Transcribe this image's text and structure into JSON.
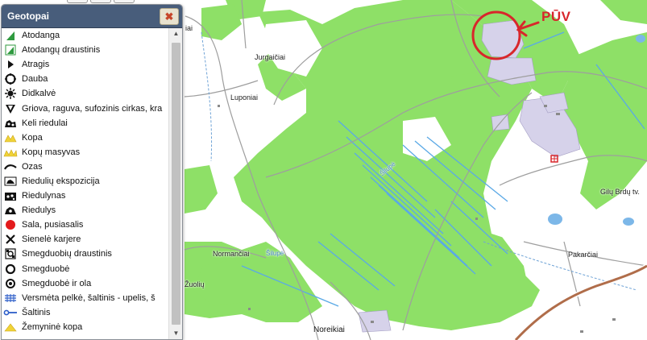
{
  "map": {
    "place_labels": {
      "jurgaiciai": "Jurgaičiai",
      "luponiai": "Luponiai",
      "normanciai": "Normančiai",
      "zuoliai": "Žuolių",
      "noreikiai": "Noreikiai",
      "pakarciai": "Pakarčiai",
      "aiai": "iai",
      "river_1": "Šilupė",
      "river_2": "Šilupė",
      "road_label": "Gilų Brdų tv."
    },
    "marker": {
      "label": "PŪV",
      "color": "#d8262b"
    },
    "colors": {
      "forest": "#8ee067",
      "field": "#ffffff",
      "industrial": "#d6d2ea",
      "water": "#7cb7e8",
      "road_main": "#b06d4a"
    }
  },
  "legend": {
    "title": "Geotopai",
    "close_label": "✖",
    "scroll_up": "▲",
    "scroll_down": "▼",
    "items": [
      {
        "label": "Atodanga",
        "icon": "cliff-icon"
      },
      {
        "label": "Atodangų draustinis",
        "icon": "cliff-reserve-icon"
      },
      {
        "label": "Atragis",
        "icon": "cape-icon"
      },
      {
        "label": "Dauba",
        "icon": "hollow-icon"
      },
      {
        "label": "Didkalvė",
        "icon": "hill-icon"
      },
      {
        "label": "Griova, raguva, sufozinis cirkas, kra",
        "icon": "ravine-icon"
      },
      {
        "label": "Keli riedulai",
        "icon": "boulders-icon"
      },
      {
        "label": "Kopa",
        "icon": "dune-icon"
      },
      {
        "label": "Kopų masyvas",
        "icon": "dune-massif-icon"
      },
      {
        "label": "Ozas",
        "icon": "esker-icon"
      },
      {
        "label": "Riedulių ekspozicija",
        "icon": "boulder-exhibit-icon"
      },
      {
        "label": "Riedulynas",
        "icon": "boulder-field-icon"
      },
      {
        "label": "Riedulys",
        "icon": "boulder-icon"
      },
      {
        "label": "Sala, pusiasalis",
        "icon": "island-icon"
      },
      {
        "label": "Sienelė karjere",
        "icon": "quarry-wall-icon"
      },
      {
        "label": "Smegduobių draustinis",
        "icon": "sinkhole-reserve-icon"
      },
      {
        "label": "Smegduobė",
        "icon": "sinkhole-icon"
      },
      {
        "label": "Smegduobė ir ola",
        "icon": "sinkhole-cave-icon"
      },
      {
        "label": "Versmėta pelkė, šaltinis - upelis, š",
        "icon": "spring-bog-icon"
      },
      {
        "label": "Šaltinis",
        "icon": "spring-icon"
      },
      {
        "label": "Žemyninė kopa",
        "icon": "inland-dune-icon"
      }
    ]
  }
}
